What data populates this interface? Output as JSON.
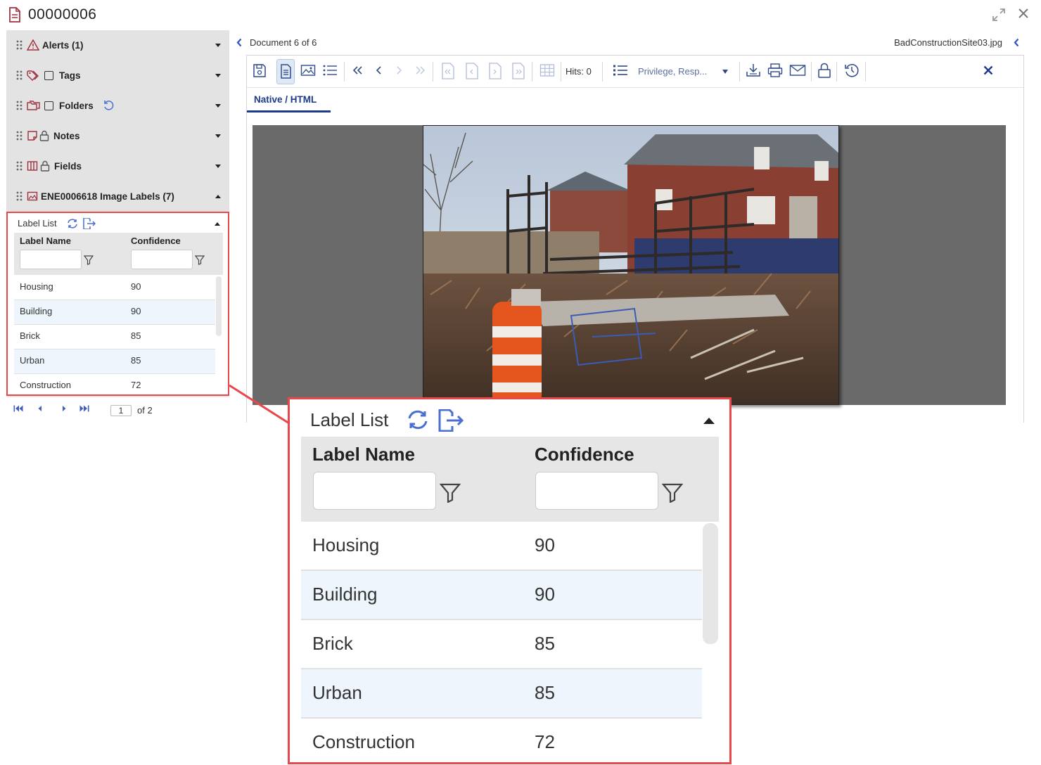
{
  "window": {
    "title": "00000006",
    "doc_icon": "document-icon",
    "expand_icon": "expand-icon",
    "close_icon": "close-icon"
  },
  "sidebar": {
    "sections": [
      {
        "label": "Alerts (1)",
        "icon": "alert-triangle-icon"
      },
      {
        "label": "Tags",
        "icon": "tags-icon"
      },
      {
        "label": "Folders",
        "icon": "folders-icon"
      },
      {
        "label": "Notes",
        "icon": "notes-icon"
      },
      {
        "label": "Fields",
        "icon": "fields-icon"
      },
      {
        "label": "ENE0006618 Image Labels (7)",
        "icon": "image-icon"
      }
    ]
  },
  "label_list": {
    "title": "Label List",
    "columns": [
      "Label Name",
      "Confidence"
    ],
    "rows": [
      {
        "name": "Housing",
        "confidence": "90"
      },
      {
        "name": "Building",
        "confidence": "90"
      },
      {
        "name": "Brick",
        "confidence": "85"
      },
      {
        "name": "Urban",
        "confidence": "85"
      },
      {
        "name": "Construction",
        "confidence": "72"
      }
    ]
  },
  "pager": {
    "page": "1",
    "of_label": "of 2"
  },
  "viewer": {
    "doc_position": "Document 6 of 6",
    "filename": "BadConstructionSite03.jpg",
    "hits": "Hits: 0",
    "privilege": "Privilege, Resp...",
    "tab": "Native / HTML"
  },
  "colors": {
    "accent": "#1d3b8a",
    "highlight": "#e8484b",
    "sidebar_bg": "#e3e3e3",
    "row_alt": "#eef5fc",
    "icon_red": "#a1313f"
  }
}
